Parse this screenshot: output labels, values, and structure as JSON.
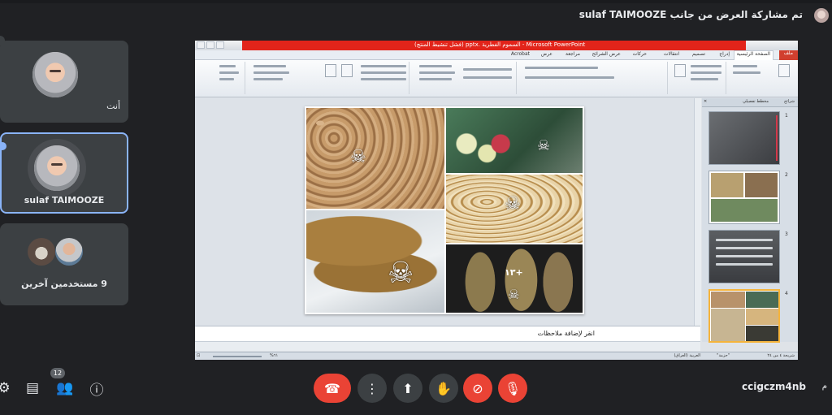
{
  "share_banner": {
    "text": "تم مشاركة العرض من جانب sulaf TAIMOOZE"
  },
  "participants": {
    "self_label": "أنت",
    "presenter_name": "sulaf TAIMOOZE",
    "others_label": "9 مستخدمين آخرين"
  },
  "presentation": {
    "window_title": "Microsoft PowerPoint - السموم الفطرية .pptx (فشل تنشيط المنتج)",
    "ribbon_tabs": [
      "ملف",
      "الصفحة الرئيسية",
      "إدراج",
      "تصميم",
      "انتقالات",
      "حركات",
      "عرض الشرائح",
      "مراجعة",
      "عرض",
      "Acrobat"
    ],
    "slide_corn_label": "١٣+",
    "notes_placeholder": "انقر لإضافة ملاحظات",
    "thumb_tabs": [
      "شرائح",
      "مخطط تفصيلي"
    ],
    "thumb_numbers": [
      "1",
      "2",
      "3",
      "4"
    ],
    "status_left": "%٦١",
    "status_right": "شريحة ٤ من ٢٤",
    "status_theme": "\"حزمة\"",
    "status_lang": "العربية (العراق)"
  },
  "controls": {
    "participant_count": "12",
    "meeting_code": "ccigczm4nb",
    "meeting_code_tail": "م"
  },
  "icons": {
    "end_call": "phone-hangup-icon",
    "more": "more-vert-icon",
    "present": "present-screen-icon",
    "raise_hand": "raise-hand-icon",
    "camera_off": "videocam-off-icon",
    "mic_off": "mic-off-icon",
    "chat": "chat-icon",
    "people": "people-icon",
    "info": "info-icon",
    "activities": "activities-icon"
  },
  "colors": {
    "background": "#202124",
    "tile": "#3c4043",
    "active_border": "#8ab4f8",
    "danger": "#ea4335",
    "ppt_titlebar": "#e2241a"
  }
}
